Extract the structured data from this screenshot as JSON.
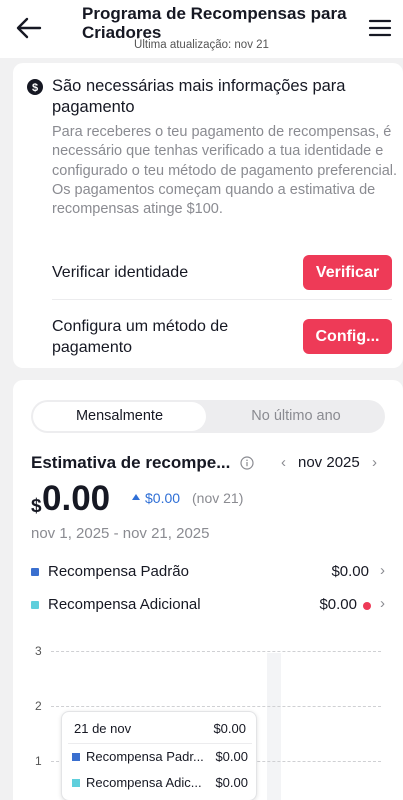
{
  "header": {
    "title": "Programa de Recompensas para Criadores",
    "subtitle": "Última atualização: nov 21",
    "back_icon": "arrow-left-icon",
    "menu_icon": "hamburger-menu-icon"
  },
  "payment_info": {
    "icon": "dollar-circle-icon",
    "title": "São necessárias mais informações para pagamento",
    "body": "Para receberes o teu pagamento de recompensas, é necessário que tenhas verificado a tua identidade e configurado o teu método de pagamento preferencial. Os pagamentos começam quando a estimativa de recompensas atinge $100.",
    "actions": [
      {
        "label": "Verificar identidade",
        "button": "Verificar"
      },
      {
        "label": "Configura um método de pagamento",
        "button": "Config..."
      }
    ]
  },
  "estimate": {
    "tabs": [
      "Mensalmente",
      "No último ano"
    ],
    "active_tab": "Mensalmente",
    "title": "Estimativa de recompe...",
    "month": "nov 2025",
    "currency": "$",
    "amount": "0.00",
    "delta": "$0.00",
    "delta_date": "(nov 21)",
    "range": "nov 1, 2025 - nov 21, 2025",
    "legend": [
      {
        "name": "Recompensa Padrão",
        "value": "$0.00",
        "color": "#3a6fcf"
      },
      {
        "name": "Recompensa Adicional",
        "value": "$0.00",
        "color": "#5fcfdc"
      }
    ]
  },
  "chart_data": {
    "type": "bar",
    "ytick_labels": [
      "3",
      "2",
      "1"
    ],
    "ylim": [
      0,
      3
    ],
    "series": [
      {
        "name": "Recompensa Padrão",
        "values": [
          0
        ]
      },
      {
        "name": "Recompensa Adicional",
        "values": [
          0
        ]
      }
    ],
    "tooltip": {
      "date": "21 de nov",
      "total": "$0.00",
      "rows": [
        {
          "name": "Recompensa Padr...",
          "value": "$0.00"
        },
        {
          "name": "Recompensa Adic...",
          "value": "$0.00"
        }
      ]
    }
  },
  "colors": {
    "accent": "#ee3a57",
    "blue": "#3a6fcf",
    "cyan": "#5fcfdc",
    "delta": "#2f6fd6"
  }
}
